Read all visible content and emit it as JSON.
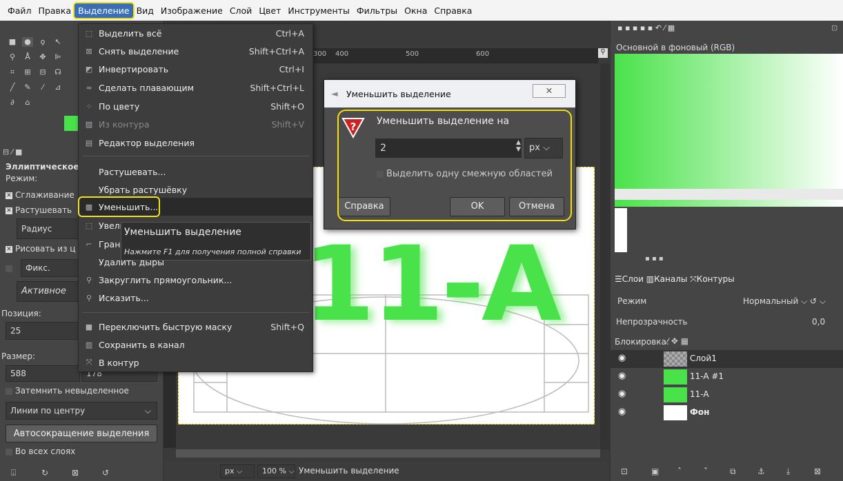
{
  "menubar": {
    "items": [
      "Файл",
      "Правка",
      "Выделение",
      "Вид",
      "Изображение",
      "Слой",
      "Цвет",
      "Инструменты",
      "Фильтры",
      "Окна",
      "Справка"
    ],
    "active_index": 2
  },
  "selection_menu": {
    "items": [
      {
        "label": "Выделить всё",
        "shortcut": "Ctrl+A",
        "icon": "select-all-icon",
        "disabled": false
      },
      {
        "label": "Снять выделение",
        "shortcut": "Shift+Ctrl+A",
        "icon": "select-none-icon",
        "disabled": false
      },
      {
        "label": "Инвертировать",
        "shortcut": "Ctrl+I",
        "icon": "invert-icon",
        "disabled": false
      },
      {
        "label": "Сделать плавающим",
        "shortcut": "Shift+Ctrl+L",
        "icon": "float-icon",
        "disabled": false
      },
      {
        "label": "По цвету",
        "shortcut": "Shift+O",
        "icon": "by-color-icon",
        "disabled": false
      },
      {
        "label": "Из контура",
        "shortcut": "Shift+V",
        "icon": "from-path-icon",
        "disabled": true
      },
      {
        "label": "Редактор выделения",
        "shortcut": "",
        "icon": "selection-editor-icon",
        "disabled": false
      },
      {
        "label": "Растушевать...",
        "shortcut": "",
        "icon": "",
        "disabled": false
      },
      {
        "label": "Убрать растушёвку",
        "shortcut": "",
        "icon": "",
        "disabled": false
      },
      {
        "label": "Уменьшить...",
        "shortcut": "",
        "icon": "shrink-icon",
        "disabled": false
      },
      {
        "label": "Увели",
        "shortcut": "",
        "icon": "grow-icon",
        "disabled": false
      },
      {
        "label": "Грани",
        "shortcut": "",
        "icon": "border-icon",
        "disabled": false
      },
      {
        "label": "Удалить дыры",
        "shortcut": "",
        "icon": "",
        "disabled": false
      },
      {
        "label": "Закруглить прямоугольник...",
        "shortcut": "",
        "icon": "round-rect-icon",
        "disabled": false
      },
      {
        "label": "Исказить...",
        "shortcut": "",
        "icon": "distort-icon",
        "disabled": false
      },
      {
        "label": "Переключить быструю маску",
        "shortcut": "Shift+Q",
        "icon": "quick-mask-icon",
        "disabled": false
      },
      {
        "label": "Сохранить в канал",
        "shortcut": "",
        "icon": "save-channel-icon",
        "disabled": false
      },
      {
        "label": "В контур",
        "shortcut": "",
        "icon": "to-path-icon",
        "disabled": false
      }
    ],
    "highlighted_index": 9
  },
  "tooltip": {
    "title": "Уменьшить выделение",
    "hint": "Нажмите F1 для получения полной справки"
  },
  "dialog": {
    "title": "Уменьшить выделение",
    "heading": "Уменьшить выделение на",
    "value": "2",
    "unit": "px",
    "checkbox_label": "Выделить одну смежную областей",
    "help": "Справка",
    "ok": "OK",
    "cancel": "Отмена"
  },
  "toolbox": {
    "tool_name": "Эллиптическое",
    "mode_label": "Режим:",
    "antialias": "Сглаживание",
    "feather": "Растушевать",
    "radius": "Радиус",
    "draw_from": "Рисовать из ц",
    "fixed": "Фикс. Соотн",
    "active": "Активное",
    "position_label": "Позиция:",
    "position_value": "25",
    "size_label": "Размер:",
    "size_w": "588",
    "size_h": "178",
    "shade": "Затемнить невыделенное",
    "guides": "Линии по центру",
    "autoshrink": "Автосокращение выделения",
    "all_layers": "Во всех слоях"
  },
  "ruler": {
    "ticks": [
      "300",
      "400",
      "500",
      "600"
    ]
  },
  "canvas_text": "11-A",
  "statusbar": {
    "unit": "px",
    "zoom": "100 %",
    "message": "Уменьшить выделение"
  },
  "right_panel": {
    "gradient_title": "Основной в фоновый (RGB)",
    "tabs": [
      "Слои",
      "Каналы",
      "Контуры"
    ],
    "mode_label": "Режим",
    "mode_value": "Нормальный",
    "opacity_label": "Непрозрачность",
    "opacity_value": "0,0",
    "lock_label": "Блокировка:",
    "layers": [
      "Слой1",
      "11-A #1",
      "11-A",
      "Фон"
    ]
  },
  "colors": {
    "fg": "#4ae24a",
    "accent": "#f5e00b",
    "menu_hl": "#2c2c2c"
  }
}
